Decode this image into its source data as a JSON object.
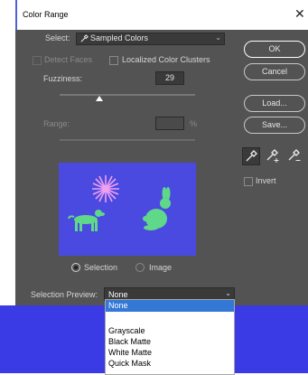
{
  "window": {
    "title": "Color Range",
    "close_icon": "close-icon"
  },
  "select": {
    "label": "Select:",
    "value": "Sampled Colors",
    "icon": "eyedropper-icon"
  },
  "options": {
    "detect_faces": "Detect Faces",
    "localized_clusters": "Localized Color Clusters"
  },
  "fuzziness": {
    "label": "Fuzziness:",
    "value": "29",
    "slider_fraction": 0.29
  },
  "range": {
    "label": "Range:",
    "unit": "%"
  },
  "buttons": {
    "ok": "OK",
    "cancel": "Cancel",
    "load": "Load...",
    "save": "Save..."
  },
  "tools": [
    "eyedropper-icon",
    "eyedropper-plus-icon",
    "eyedropper-minus-icon"
  ],
  "invert": {
    "label": "Invert"
  },
  "view": {
    "selection": "Selection",
    "image": "Image"
  },
  "preview_selection": {
    "label": "Selection Preview:",
    "value": "None",
    "options": [
      "None",
      "Grayscale",
      "Black Matte",
      "White Matte",
      "Quick Mask"
    ]
  },
  "colors": {
    "dialog_bg": "#535353",
    "preview_bg": "#4a4ae0",
    "shape_color": "#5fd88a",
    "star_color": "#f0a0f0",
    "selected_option": "#3478d6"
  }
}
